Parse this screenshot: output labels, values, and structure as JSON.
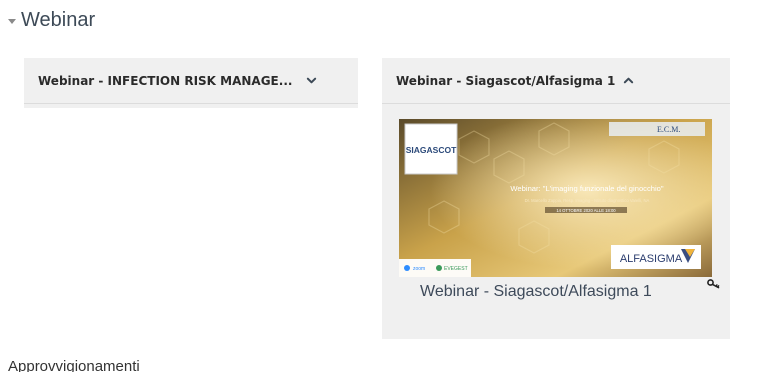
{
  "section": {
    "title": "Webinar"
  },
  "cards": [
    {
      "title": "Webinar - INFECTION RISK MANAGE...",
      "state": "collapsed",
      "icon": "chevron-down-icon"
    },
    {
      "title": "Webinar - Siagascot/Alfasigma 1",
      "state": "expanded",
      "icon": "chevron-up-icon",
      "thumbnail": {
        "logo_text": "SIAGASCOT",
        "ecm_text": "E.C.M.",
        "headline": "Webinar: \"L'imaging funzionale del ginocchio\"",
        "speaker": "Dr. Marcello Zappia, Resp. Imaging - Istituto diagnostico Varelli, NA",
        "date": "14 OTTOBRE 2020 ALLE 18:00",
        "sponsor": "ALFASIGMA",
        "platform_1": "zoom",
        "platform_2": "EVEGEST"
      },
      "activity_link": "Webinar - Siagascot/Alfasigma 1",
      "activity_icon": "key-icon"
    }
  ],
  "next_section_partial": "Approvvigionamenti"
}
